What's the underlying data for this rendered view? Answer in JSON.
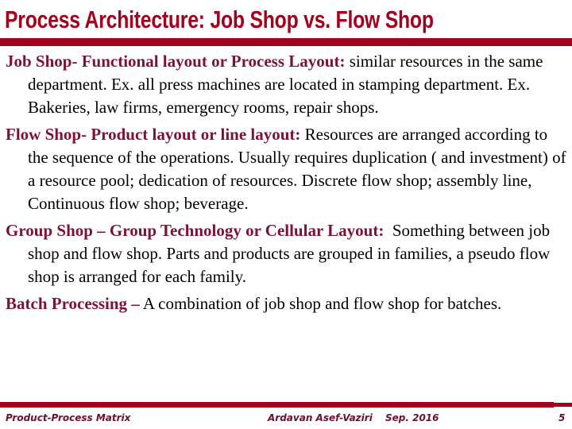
{
  "slide": {
    "title": "Process Architecture: Job Shop vs. Flow Shop",
    "colors": {
      "title": "#a3001e",
      "heading": "#7d1234",
      "body": "#000000",
      "footer": "#6e0f2c"
    }
  },
  "content": {
    "items": [
      {
        "heading": "Job Shop- Functional layout or Process Layout:",
        "body": " similar resources in the same department. Ex. all press machines are located in stamping department. Ex. Bakeries, law firms, emergency rooms, repair shops."
      },
      {
        "heading": "Flow Shop- Product layout or line layout:",
        "body": " Resources are arranged according to the sequence of the operations. Usually requires duplication ( and investment) of a resource pool; dedication of resources. Discrete flow shop; assembly line, Continuous flow shop; beverage."
      },
      {
        "heading": "Group Shop – Group Technology or Cellular Layout:",
        "body": "  Something between job shop and flow shop. Parts and products are grouped in families, a pseudo flow shop is arranged for each family."
      },
      {
        "heading": "Batch Processing –",
        "body": " A combination of job shop and flow shop for batches."
      }
    ]
  },
  "footer": {
    "left": "Product-Process Matrix",
    "author": "Ardavan Asef-Vaziri",
    "date": "Sep. 2016",
    "page_number": "5"
  }
}
